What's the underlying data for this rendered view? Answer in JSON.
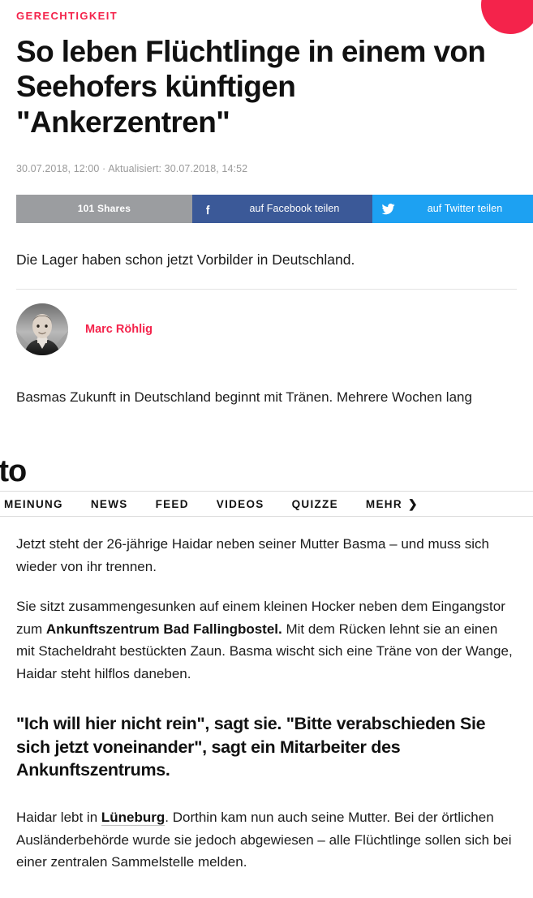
{
  "decor": {
    "corner_dot_color": "#f4234b",
    "corner_dot_name": "red-circle-decoration"
  },
  "article": {
    "kicker": "GERECHTIGKEIT",
    "headline": "So leben Flüchtlinge in einem von Seehofers künftigen \"Ankerzentren\"",
    "timestamp": "30.07.2018, 12:00 · Aktualisiert: 30.07.2018, 14:52",
    "teaser": "Die Lager haben schon jetzt Vorbilder in Deutschland."
  },
  "share": {
    "count_label": "101 Shares",
    "facebook": {
      "label": "auf Facebook teilen",
      "icon": "facebook-icon",
      "glyph": "f",
      "color": "#3b5998"
    },
    "twitter": {
      "label": "auf Twitter teilen",
      "icon": "twitter-icon",
      "glyph": "🐦",
      "color": "#1da1f2"
    }
  },
  "author": {
    "name": "Marc Röhlig",
    "avatar_alt": "portrait-photo",
    "name_color": "#f4234b"
  },
  "nav": {
    "logo": "ento",
    "items": [
      {
        "label": "MEINUNG"
      },
      {
        "label": "NEWS"
      },
      {
        "label": "FEED"
      },
      {
        "label": "VIDEOS"
      },
      {
        "label": "QUIZZE"
      },
      {
        "label": "MEHR",
        "chevron": "❯"
      }
    ]
  },
  "body": {
    "p_lead": "Basmas Zukunft in Deutschland beginnt mit Tränen. Mehrere Wochen lang",
    "p1": "Jetzt steht der 26-jährige Haidar neben seiner Mutter Basma – und muss sich wieder von ihr trennen.",
    "p2_a": "Sie sitzt zusammengesunken auf einem kleinen Hocker neben dem Eingangstor zum ",
    "p2_bold": "Ankunftszentrum Bad Fallingbostel.",
    "p2_b": " Mit dem Rücken lehnt sie an einen mit Stacheldraht bestückten Zaun. Basma wischt sich eine Träne von der Wange, Haidar steht hilflos daneben.",
    "pullquote": "\"Ich will hier nicht rein\", sagt sie. \"Bitte verabschieden Sie sich jetzt voneinander\", sagt ein Mitarbeiter des Ankunftszentrums.",
    "p3_a": "Haidar lebt in ",
    "p3_link": "Lüneburg",
    "p3_b": ". Dorthin kam nun auch seine Mutter. Bei der örtlichen Ausländerbehörde wurde sie jedoch abgewiesen – alle Flüchtlinge sollen sich bei einer zentralen Sammelstelle melden."
  }
}
